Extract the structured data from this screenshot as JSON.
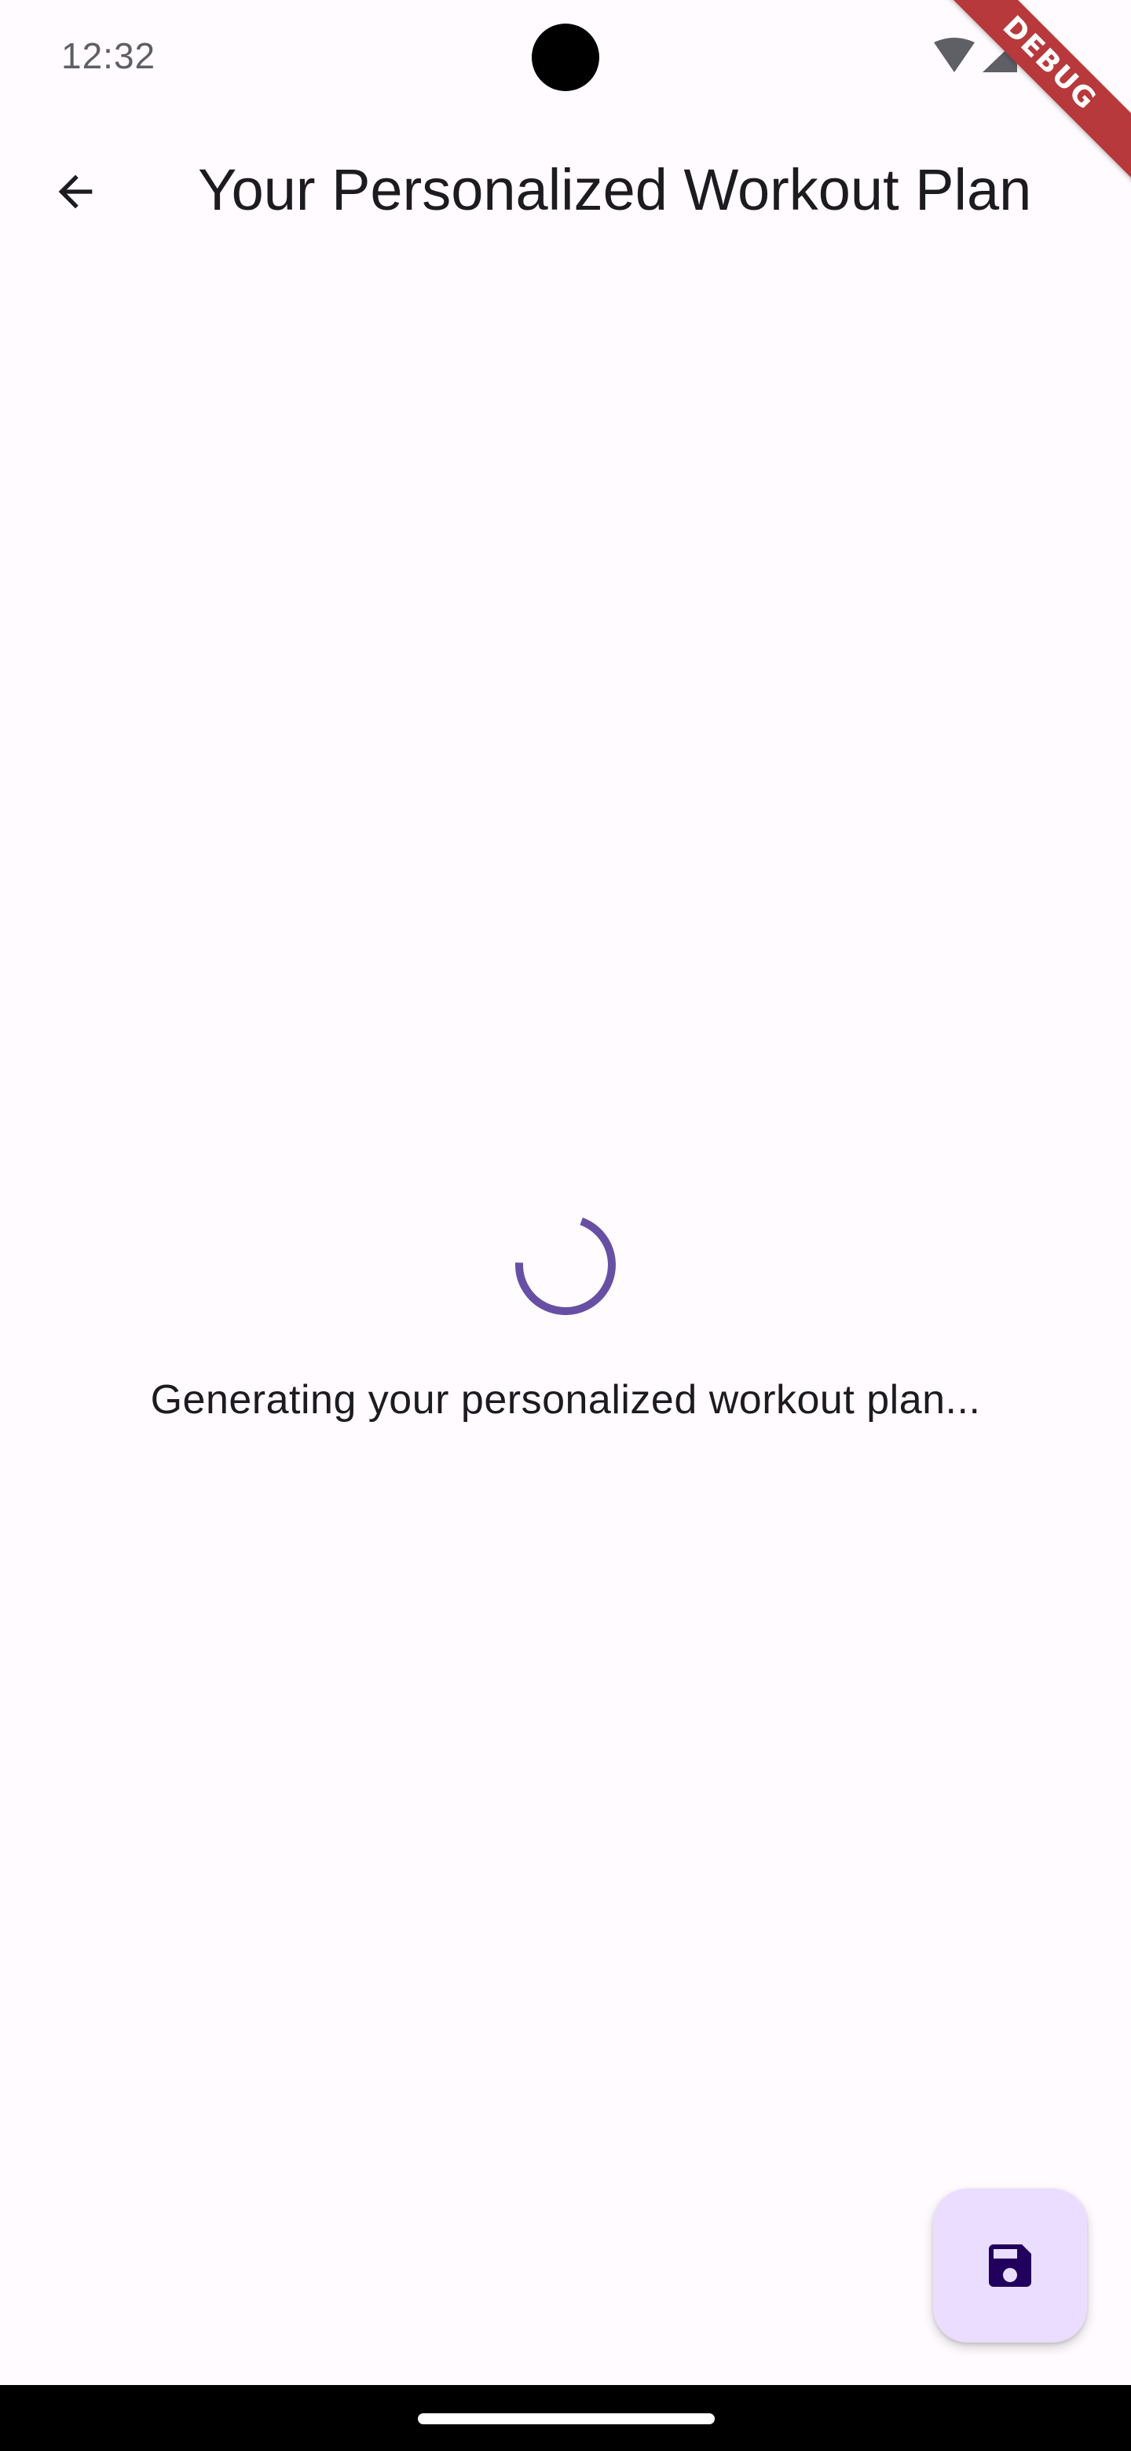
{
  "status_bar": {
    "time": "12:32"
  },
  "debug_banner": {
    "label": "DEBUG"
  },
  "app_bar": {
    "title": "Your Personalized Workout Plan",
    "back_icon": "arrow-back-icon"
  },
  "main": {
    "loading_message": "Generating your personalized workout plan...",
    "spinner_color": "#6750a4"
  },
  "fab": {
    "icon": "save-icon",
    "background": "#eaddff",
    "icon_color": "#21005d"
  },
  "colors": {
    "background": "#fffbfe",
    "text_primary": "#1c1b1f",
    "debug_banner": "#b8393b"
  }
}
